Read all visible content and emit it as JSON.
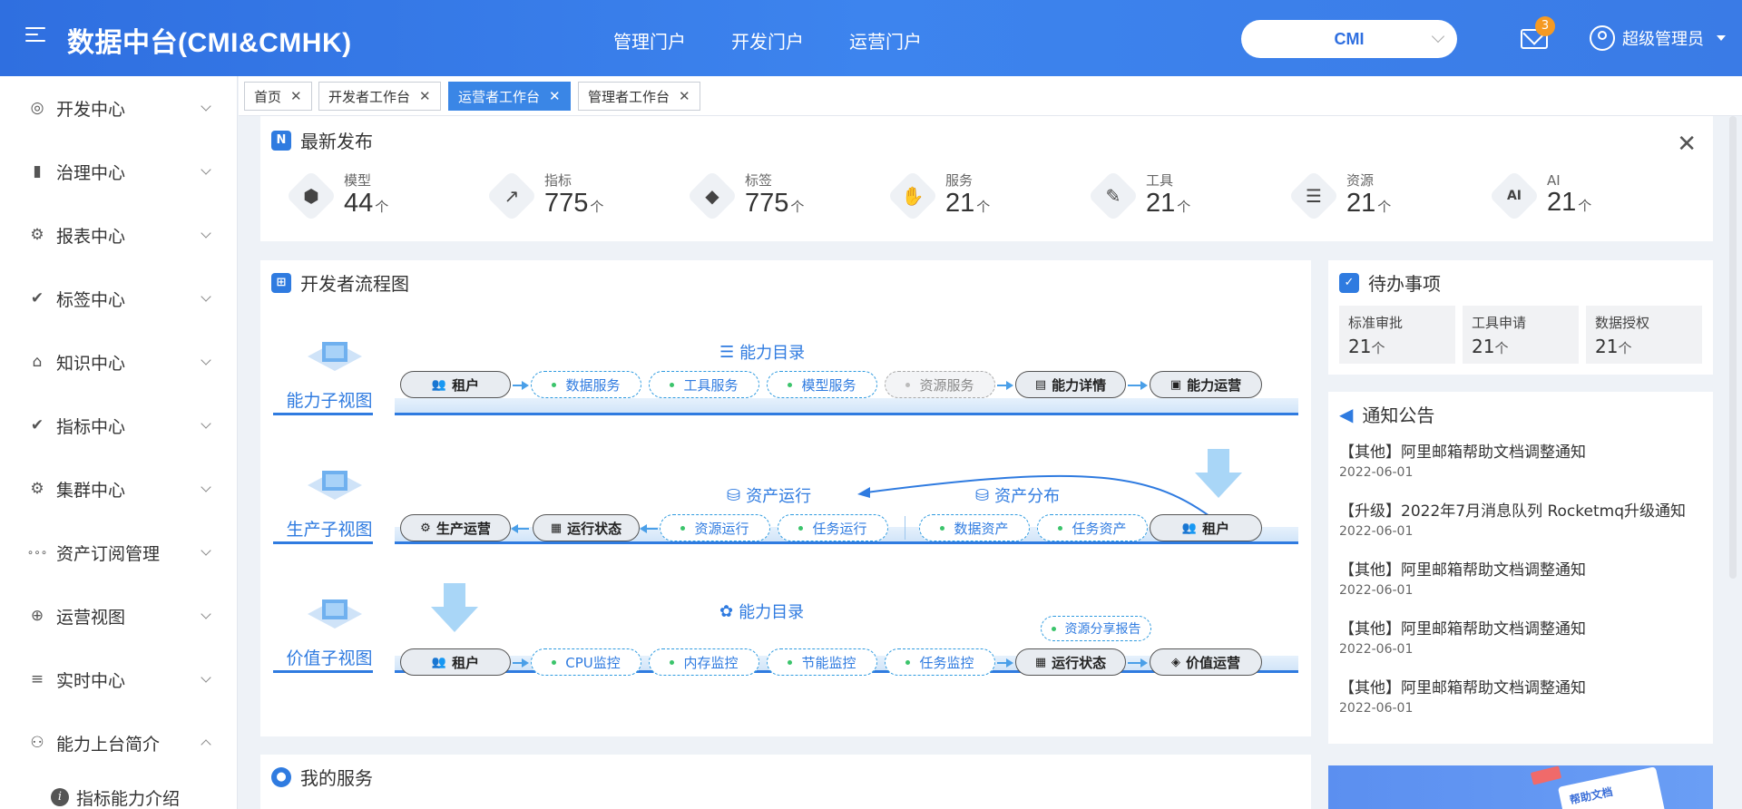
{
  "header": {
    "title": "数据中台(CMI&CMHK)",
    "nav": [
      "管理门户",
      "开发门户",
      "运营门户"
    ],
    "org": "CMI",
    "mail_count": "3",
    "user": "超级管理员"
  },
  "sidebar": {
    "items": [
      {
        "label": "开发中心",
        "icon": "eye-icon",
        "glyph": "◎"
      },
      {
        "label": "治理中心",
        "icon": "bar-chart-icon",
        "glyph": "▮"
      },
      {
        "label": "报表中心",
        "icon": "gear-icon",
        "glyph": "⚙"
      },
      {
        "label": "标签中心",
        "icon": "check-circle-icon",
        "glyph": "✔"
      },
      {
        "label": "知识中心",
        "icon": "bag-icon",
        "glyph": "⌂"
      },
      {
        "label": "指标中心",
        "icon": "check-circle-icon",
        "glyph": "✔"
      },
      {
        "label": "集群中心",
        "icon": "gear-icon",
        "glyph": "⚙"
      },
      {
        "label": "资产订阅管理",
        "icon": "dots-icon",
        "glyph": "∘∘∘"
      },
      {
        "label": "运营视图",
        "icon": "plus-circle-icon",
        "glyph": "⊕"
      },
      {
        "label": "实时中心",
        "icon": "list-check-icon",
        "glyph": "≡"
      },
      {
        "label": "能力上台简介",
        "icon": "user-icon",
        "glyph": "⚇"
      }
    ],
    "sub_item": "指标能力介绍"
  },
  "tabs": [
    {
      "label": "首页",
      "active": false
    },
    {
      "label": "开发者工作台",
      "active": false
    },
    {
      "label": "运营者工作台",
      "active": true
    },
    {
      "label": "管理者工作台",
      "active": false
    }
  ],
  "latest": {
    "title": "最新发布",
    "unit": "个",
    "stats": [
      {
        "label": "模型",
        "value": "44",
        "icon": "cube-icon",
        "glyph": "⬢"
      },
      {
        "label": "指标",
        "value": "775",
        "icon": "trend-icon",
        "glyph": "↗"
      },
      {
        "label": "标签",
        "value": "775",
        "icon": "tag-icon",
        "glyph": "◆"
      },
      {
        "label": "服务",
        "value": "21",
        "icon": "handshake-icon",
        "glyph": "✋"
      },
      {
        "label": "工具",
        "value": "21",
        "icon": "wrench-icon",
        "glyph": "✎"
      },
      {
        "label": "资源",
        "value": "21",
        "icon": "layers-icon",
        "glyph": "☰"
      },
      {
        "label": "AI",
        "value": "21",
        "icon": "ai-icon",
        "glyph": "AI"
      }
    ]
  },
  "flow": {
    "title": "开发者流程图",
    "row1": {
      "label": "能力子视图",
      "group": "能力目录",
      "tenant": "租户",
      "items": [
        "数据服务",
        "工具服务",
        "模型服务"
      ],
      "disabled": "资源服务",
      "detail": "能力详情",
      "ops": "能力运营"
    },
    "row2": {
      "label": "生产子视图",
      "group_left": "资产运行",
      "group_right": "资产分布",
      "prod": "生产运营",
      "status": "运行状态",
      "items_left": [
        "资源运行",
        "任务运行"
      ],
      "items_right": [
        "数据资产",
        "任务资产"
      ],
      "tenant": "租户"
    },
    "row3": {
      "label": "价值子视图",
      "group": "能力目录",
      "tenant": "租户",
      "items": [
        "CPU监控",
        "内存监控",
        "节能监控",
        "任务监控"
      ],
      "report": "资源分享报告",
      "status": "运行状态",
      "value_ops": "价值运营"
    }
  },
  "todo": {
    "title": "待办事项",
    "unit": "个",
    "items": [
      {
        "label": "标准审批",
        "value": "21"
      },
      {
        "label": "工具申请",
        "value": "21"
      },
      {
        "label": "数据授权",
        "value": "21"
      }
    ]
  },
  "notices": {
    "title": "通知公告",
    "items": [
      {
        "title": "【其他】阿里邮箱帮助文档调整通知",
        "date": "2022-06-01"
      },
      {
        "title": "【升级】2022年7月消息队列 Rocketmq升级通知",
        "date": "2022-06-01"
      },
      {
        "title": "【其他】阿里邮箱帮助文档调整通知",
        "date": "2022-06-01"
      },
      {
        "title": "【其他】阿里邮箱帮助文档调整通知",
        "date": "2022-06-01"
      },
      {
        "title": "【其他】阿里邮箱帮助文档调整通知",
        "date": "2022-06-01"
      }
    ]
  },
  "services": {
    "title": "我的服务"
  },
  "banner": {
    "text": "帮助文档"
  },
  "colors": {
    "primary": "#2f7be0",
    "header": "#3a7be6",
    "active_tab": "#3a86e6",
    "badge": "#f59a23"
  }
}
